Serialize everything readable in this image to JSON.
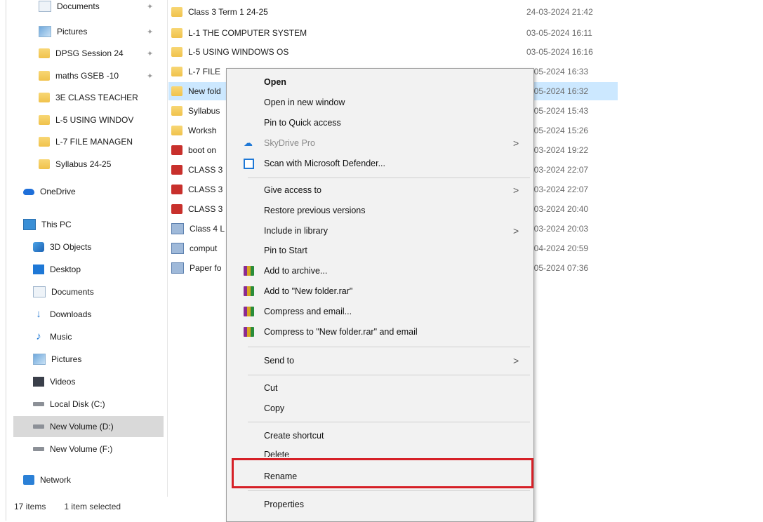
{
  "navigation": {
    "items": [
      {
        "label": "Documents",
        "icon": "documents-icon",
        "pinned": true
      },
      {
        "label": "Pictures",
        "icon": "pictures-icon",
        "pinned": true
      },
      {
        "label": "DPSG Session 24",
        "icon": "folder-icon",
        "pinned": true
      },
      {
        "label": "maths GSEB -10",
        "icon": "folder-icon",
        "pinned": true
      },
      {
        "label": "3E CLASS TEACHER",
        "icon": "folder-icon",
        "pinned": false
      },
      {
        "label": "L-5 USING WINDOV",
        "icon": "folder-icon",
        "pinned": false
      },
      {
        "label": "L-7 FILE MANAGEN",
        "icon": "folder-icon",
        "pinned": false
      },
      {
        "label": "Syllabus 24-25",
        "icon": "folder-icon",
        "pinned": false
      },
      {
        "label": "OneDrive",
        "icon": "onedrive-icon",
        "pinned": false
      },
      {
        "label": "This PC",
        "icon": "this-pc-icon",
        "pinned": false
      },
      {
        "label": "3D Objects",
        "icon": "3d-objects-icon",
        "pinned": false
      },
      {
        "label": "Desktop",
        "icon": "desktop-icon",
        "pinned": false
      },
      {
        "label": "Documents",
        "icon": "documents-icon",
        "pinned": false
      },
      {
        "label": "Downloads",
        "icon": "downloads-icon",
        "pinned": false
      },
      {
        "label": "Music",
        "icon": "music-icon",
        "pinned": false
      },
      {
        "label": "Pictures",
        "icon": "pictures-icon",
        "pinned": false
      },
      {
        "label": "Videos",
        "icon": "videos-icon",
        "pinned": false
      },
      {
        "label": "Local Disk (C:)",
        "icon": "drive-icon",
        "pinned": false
      },
      {
        "label": "New Volume (D:)",
        "icon": "drive-icon",
        "pinned": false,
        "selected": true
      },
      {
        "label": "New Volume (F:)",
        "icon": "drive-icon",
        "pinned": false
      },
      {
        "label": "Network",
        "icon": "network-icon",
        "pinned": false
      }
    ]
  },
  "files": [
    {
      "name": "Class 3 Term 1 24-25",
      "date": "24-03-2024 21:42",
      "icon": "folder-icon"
    },
    {
      "name": "L-1 THE COMPUTER SYSTEM",
      "date": "03-05-2024 16:11",
      "icon": "folder-icon"
    },
    {
      "name": "L-5 USING WINDOWS OS",
      "date": "03-05-2024 16:16",
      "icon": "folder-icon"
    },
    {
      "name": "L-7 FILE",
      "date": "8-05-2024 16:33",
      "icon": "folder-icon"
    },
    {
      "name": "New fold",
      "date": "3-05-2024 16:32",
      "icon": "folder-icon",
      "selected": true
    },
    {
      "name": "Syllabus",
      "date": "3-05-2024 15:43",
      "icon": "folder-icon"
    },
    {
      "name": "Worksh",
      "date": "8-05-2024 15:26",
      "icon": "folder-icon"
    },
    {
      "name": "boot on",
      "date": "8-03-2024 19:22",
      "icon": "pdf-icon"
    },
    {
      "name": "CLASS 3",
      "date": "5-03-2024 22:07",
      "icon": "pdf-icon"
    },
    {
      "name": "CLASS 3",
      "date": "5-03-2024 22:07",
      "icon": "pdf-icon"
    },
    {
      "name": "CLASS 3",
      "date": "4-03-2024 20:40",
      "icon": "pdf-icon"
    },
    {
      "name": "Class 4 L",
      "date": "5-03-2024 20:03",
      "icon": "word-icon"
    },
    {
      "name": "comput",
      "date": "9-04-2024 20:59",
      "icon": "word-icon"
    },
    {
      "name": "Paper fo",
      "date": "5-05-2024 07:36",
      "icon": "word-icon"
    }
  ],
  "status": {
    "count": "17 items",
    "selection": "1 item selected"
  },
  "context_menu": {
    "items": [
      {
        "label": "Open",
        "bold": true
      },
      {
        "label": "Open in new window"
      },
      {
        "label": "Pin to Quick access"
      },
      {
        "label": "SkyDrive Pro",
        "disabled": true,
        "submenu": true,
        "icon": "skydrive-icon"
      },
      {
        "label": "Scan with Microsoft Defender...",
        "icon": "defender-icon"
      },
      {
        "label": "Give access to",
        "submenu": true
      },
      {
        "label": "Restore previous versions"
      },
      {
        "label": "Include in library",
        "submenu": true
      },
      {
        "label": "Pin to Start"
      },
      {
        "label": "Add to archive...",
        "icon": "winrar-icon"
      },
      {
        "label": "Add to \"New folder.rar\"",
        "icon": "winrar-icon"
      },
      {
        "label": "Compress and email...",
        "icon": "winrar-icon"
      },
      {
        "label": "Compress to \"New folder.rar\" and email",
        "icon": "winrar-icon"
      },
      {
        "label": "Send to",
        "submenu": true
      },
      {
        "label": "Cut"
      },
      {
        "label": "Copy"
      },
      {
        "label": "Create shortcut"
      },
      {
        "label": "Delete"
      },
      {
        "label": "Rename",
        "highlighted": true
      },
      {
        "label": "Properties"
      }
    ],
    "submenu_arrow": ">"
  },
  "colors": {
    "selection": "#cce8ff",
    "highlight_box": "#d62027",
    "menu_bg": "#f2f2f2"
  }
}
